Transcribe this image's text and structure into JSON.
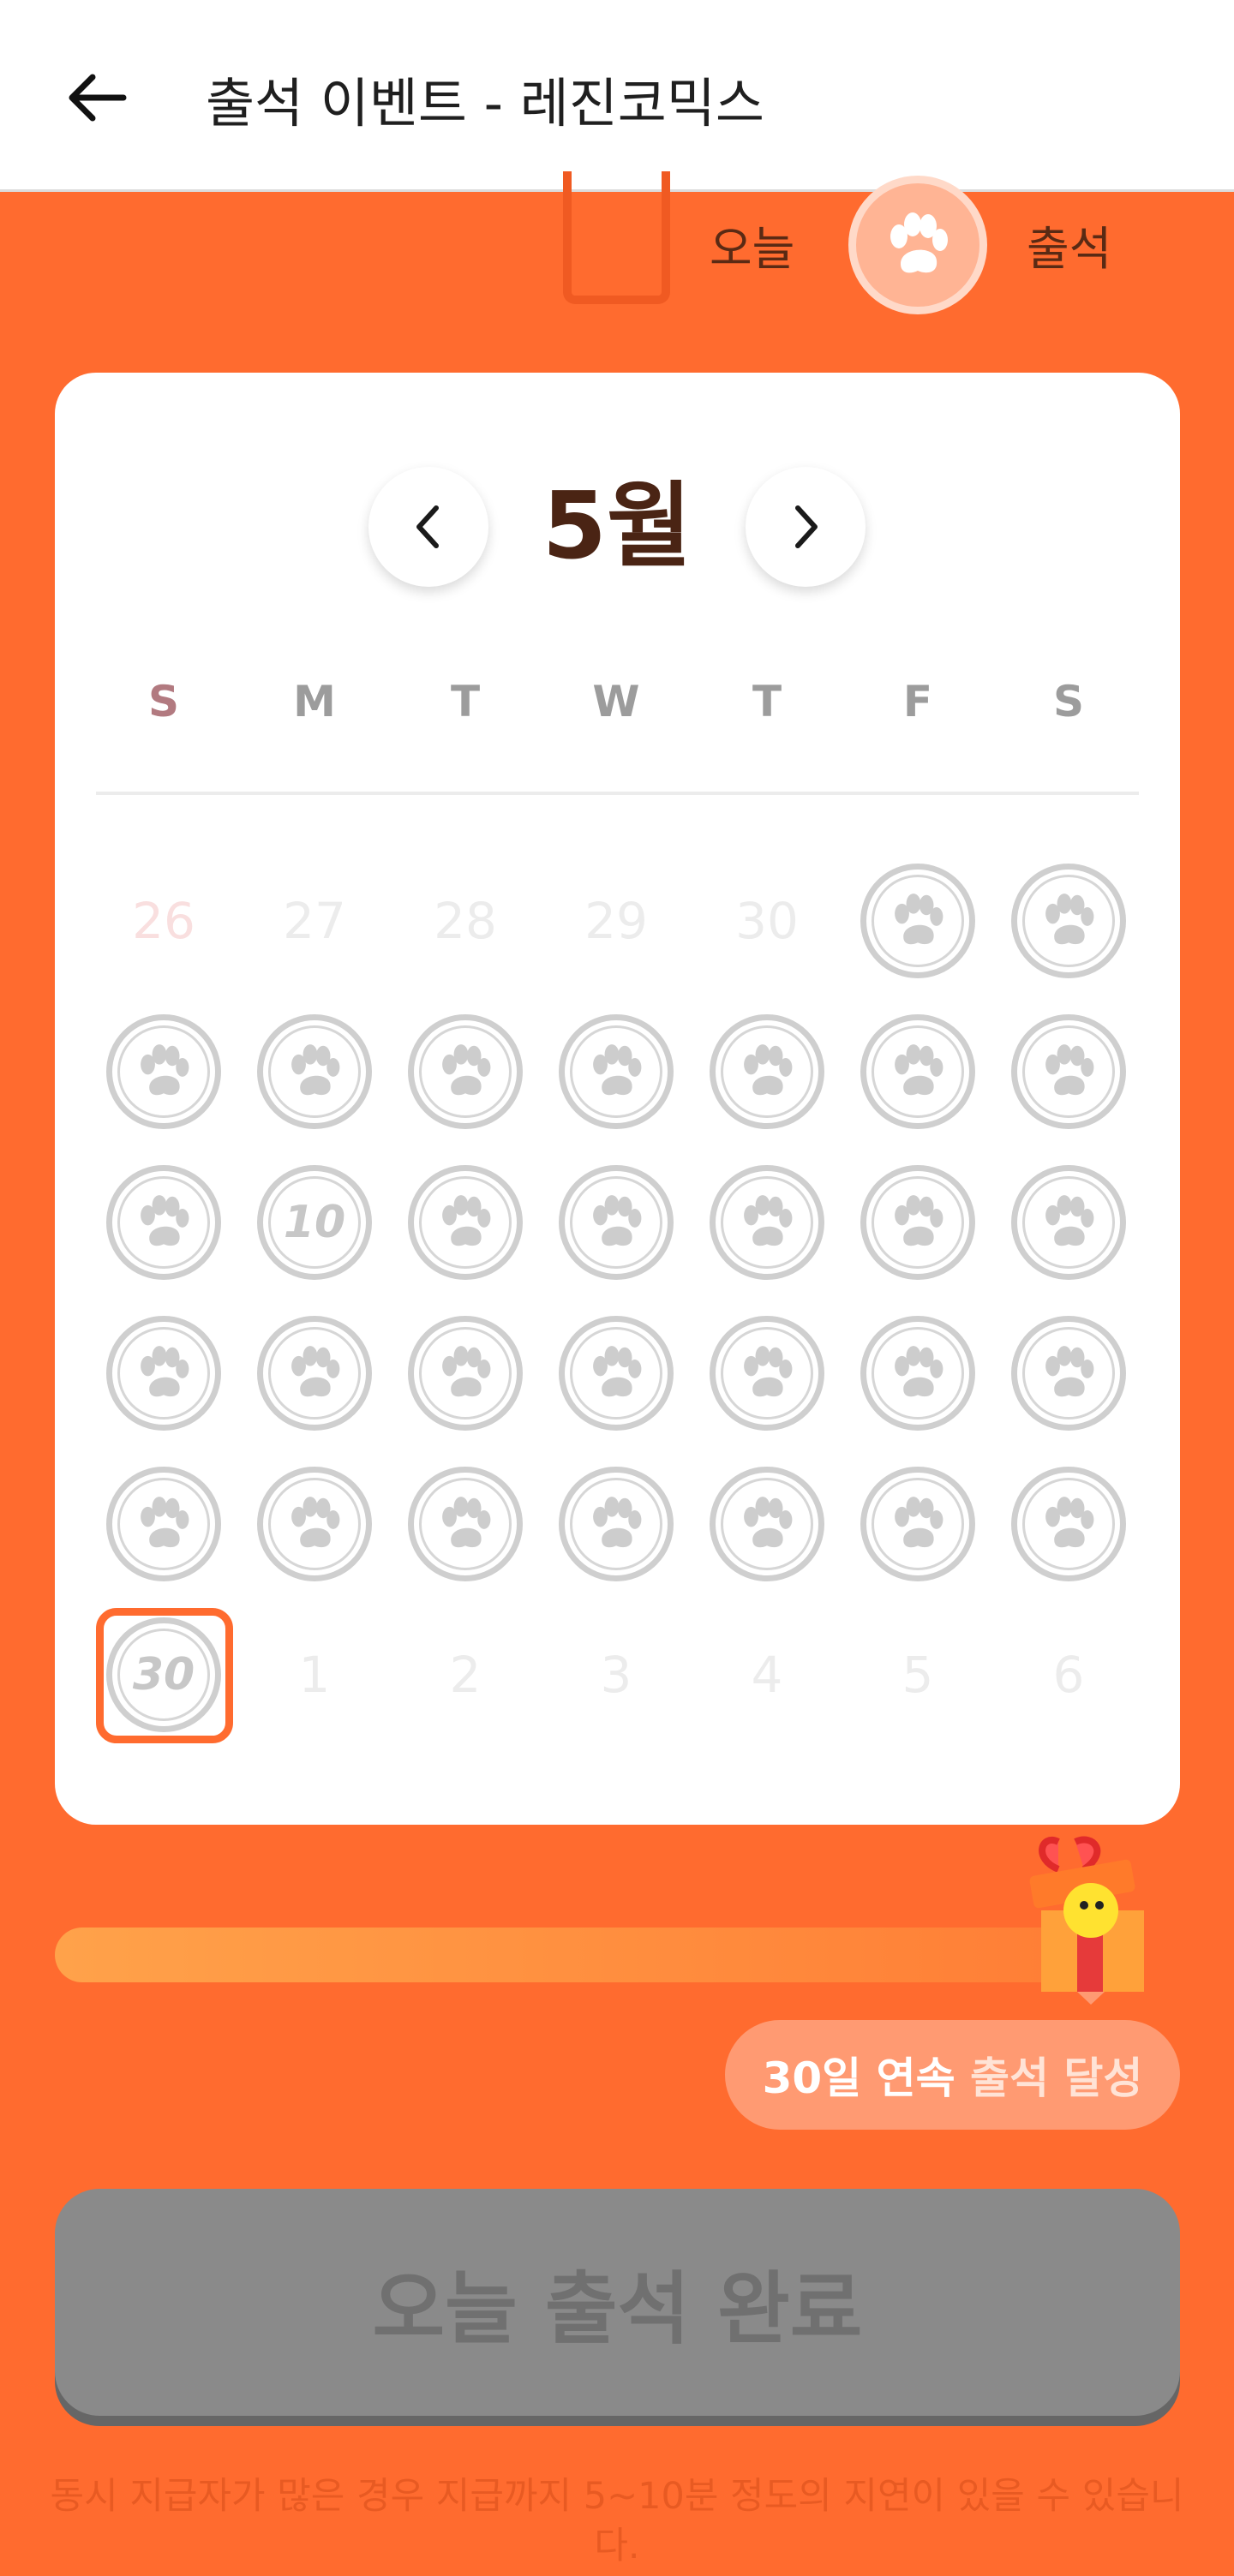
{
  "header": {
    "title": "출석 이벤트 - 레진코믹스"
  },
  "legend": {
    "today_label": "오늘",
    "attended_label": "출석"
  },
  "calendar": {
    "month_label": "5월",
    "weekdays": [
      "S",
      "M",
      "T",
      "W",
      "T",
      "F",
      "S"
    ],
    "rows": [
      [
        {
          "t": "num",
          "v": "26"
        },
        {
          "t": "num",
          "v": "27"
        },
        {
          "t": "num",
          "v": "28"
        },
        {
          "t": "num",
          "v": "29"
        },
        {
          "t": "num",
          "v": "30"
        },
        {
          "t": "paw"
        },
        {
          "t": "paw"
        }
      ],
      [
        {
          "t": "paw"
        },
        {
          "t": "paw"
        },
        {
          "t": "paw"
        },
        {
          "t": "paw"
        },
        {
          "t": "paw"
        },
        {
          "t": "paw"
        },
        {
          "t": "paw"
        }
      ],
      [
        {
          "t": "paw"
        },
        {
          "t": "special",
          "v": "10"
        },
        {
          "t": "paw"
        },
        {
          "t": "paw"
        },
        {
          "t": "paw"
        },
        {
          "t": "paw"
        },
        {
          "t": "paw"
        }
      ],
      [
        {
          "t": "paw"
        },
        {
          "t": "paw"
        },
        {
          "t": "paw"
        },
        {
          "t": "paw"
        },
        {
          "t": "paw"
        },
        {
          "t": "paw"
        },
        {
          "t": "paw"
        }
      ],
      [
        {
          "t": "paw"
        },
        {
          "t": "paw"
        },
        {
          "t": "paw"
        },
        {
          "t": "paw"
        },
        {
          "t": "paw"
        },
        {
          "t": "paw"
        },
        {
          "t": "paw"
        }
      ],
      [
        {
          "t": "special",
          "v": "30"
        },
        {
          "t": "num",
          "v": "1"
        },
        {
          "t": "num",
          "v": "2"
        },
        {
          "t": "num",
          "v": "3"
        },
        {
          "t": "num",
          "v": "4"
        },
        {
          "t": "num",
          "v": "5"
        },
        {
          "t": "num",
          "v": "6"
        }
      ]
    ]
  },
  "progress": {
    "fraction": 1.0
  },
  "streak": {
    "bold": "30일 연속",
    "rest": "출석 달성"
  },
  "button": {
    "label": "오늘 출석 완료"
  },
  "notice": "동시 지급자가 많은 경우 지급까지 5~10분 정도의 지연이 있을 수 있습니다.",
  "colors": {
    "accent": "#ff6b2f",
    "month_text": "#4a2414",
    "coin_gray": "#cfcfcf"
  }
}
